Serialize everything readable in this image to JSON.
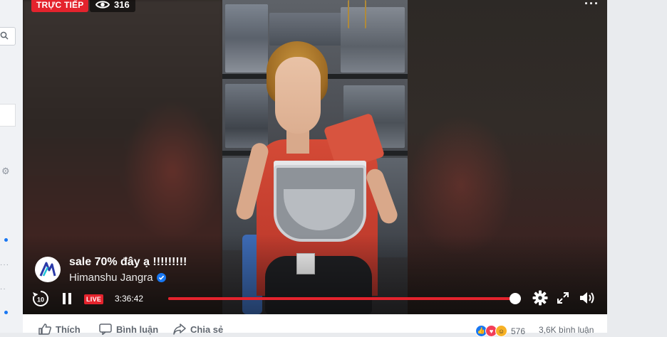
{
  "video": {
    "live_badge": "TRỰC TIẾP",
    "viewer_count": "316",
    "title": "sale 70% đây ạ !!!!!!!!!",
    "author": "Himanshu Jangra",
    "live_label": "LIVE",
    "elapsed_time": "3:36:42",
    "progress": 0.99,
    "rewind_seconds": "10",
    "accent_color": "#e4232d"
  },
  "actions": {
    "like": "Thích",
    "comment": "Bình luận",
    "share": "Chia sẻ"
  },
  "stats": {
    "reaction_count": "576",
    "comment_count": "3,6K bình luận"
  }
}
